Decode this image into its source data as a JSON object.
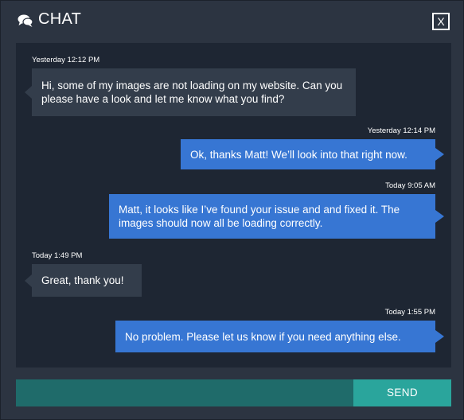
{
  "header": {
    "title": "CHAT",
    "close_label": "X"
  },
  "messages": [
    {
      "direction": "incoming",
      "time": "Yesterday 12:12 PM",
      "text": "Hi, some of my images are not loading on my website. Can you please have a look and let me know what you find?"
    },
    {
      "direction": "outgoing",
      "time": "Yesterday 12:14 PM",
      "text": "Ok, thanks Matt! We’ll look into that right now."
    },
    {
      "direction": "outgoing",
      "time": "Today 9:05 AM",
      "text": "Matt, it looks like I’ve found your issue and and fixed it. The images should now all be loading correctly."
    },
    {
      "direction": "incoming",
      "time": "Today 1:49 PM",
      "text": "Great, thank you!"
    },
    {
      "direction": "outgoing",
      "time": "Today 1:55 PM",
      "text": "No problem. Please let us know if you need anything else."
    }
  ],
  "composer": {
    "value": "",
    "placeholder": "",
    "send_label": "SEND"
  },
  "colors": {
    "window_bg": "#2c3441",
    "messages_bg": "#1e2633",
    "incoming_bubble": "#333d4b",
    "outgoing_bubble": "#3776d3",
    "input_bg": "#1f6b6a",
    "send_bg": "#2aa59c"
  },
  "icons": {
    "header_icon": "chat-bubbles-icon"
  }
}
